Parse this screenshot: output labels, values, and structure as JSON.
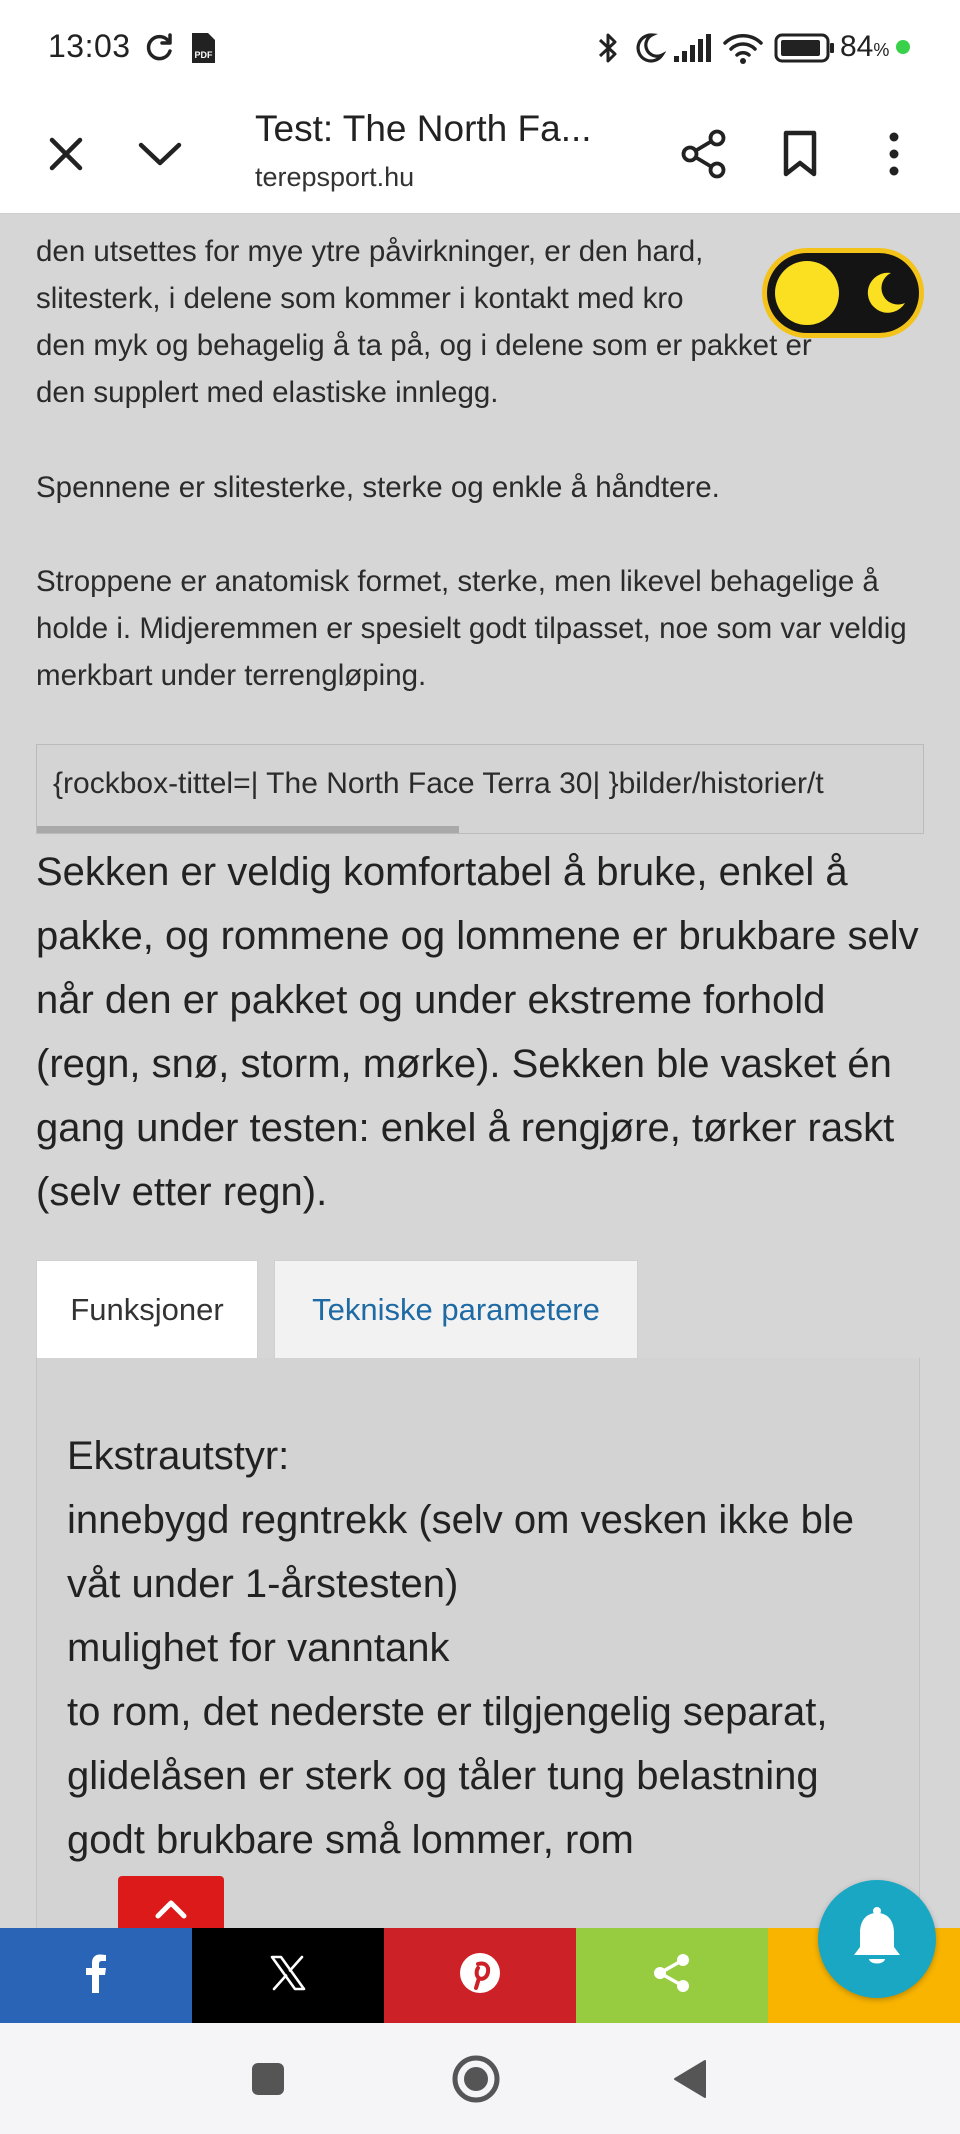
{
  "status_bar": {
    "time": "13:03",
    "battery_percent": "84",
    "battery_unit": "%",
    "icons": [
      "sync-icon",
      "pdf-icon",
      "bluetooth-icon",
      "moon-icon",
      "signal-icon",
      "wifi-icon",
      "battery-icon"
    ]
  },
  "toolbar": {
    "title": "Test: The North Fa...",
    "url": "terepsport.hu",
    "icons": [
      "close-icon",
      "chevron-down-icon",
      "share-icon",
      "bookmark-icon",
      "more-icon"
    ]
  },
  "article": {
    "para1_lines": [
      "den utsettes for mye ytre påvirkninger, er den hard,",
      "slitesterk, i delene som kommer i kontakt med kro",
      "den myk og behagelig å ta på, og i delene som er pakket er",
      "den supplert med elastiske innlegg."
    ],
    "para2": "Spennene er slitesterke, sterke og enkle å håndtere.",
    "para3": "Stroppene er anatomisk formet, sterke, men likevel behagelige å holde i. Midjeremmen er spesielt godt tilpasset, noe som var veldig merkbart under terrengløping.",
    "rockbox_text": "{rockbox-tittel=| The North Face Terra 30| }bilder/historier/t",
    "para4": "Sekken er veldig komfortabel å bruke, enkel å pakke, og rommene og lommene er brukbare selv når den er pakket og under ekstreme forhold (regn, snø, storm, mørke). Sekken ble vasket én gang under testen: enkel å rengjøre, tørker raskt (selv etter regn)."
  },
  "tabs": {
    "active": "Funksjoner",
    "inactive": "Tekniske parametere"
  },
  "panel": {
    "lines": [
      "Ekstrautstyr:",
      "innebygd regntrekk (selv om vesken ikke ble",
      "våt under 1-årstesten)",
      "mulighet for vanntank",
      "to rom, det nederste er tilgjengelig separat,",
      "glidelåsen er sterk og tåler tung belastning",
      "godt brukbare små lommer, rom"
    ]
  },
  "share_bar": {
    "buttons": [
      {
        "name": "facebook",
        "color": "#2a64b7"
      },
      {
        "name": "x",
        "color": "#000000"
      },
      {
        "name": "pinterest",
        "color": "#cb2127"
      },
      {
        "name": "share",
        "color": "#98cc40"
      },
      {
        "name": "more",
        "color": "#f9b400"
      }
    ]
  },
  "colors": {
    "page_bg": "#d6d6d6",
    "toggle_border": "#f3c31a",
    "bell": "#19a7c4",
    "scroll_top": "#dc1a1a",
    "tab_link": "#1d6aa5"
  }
}
